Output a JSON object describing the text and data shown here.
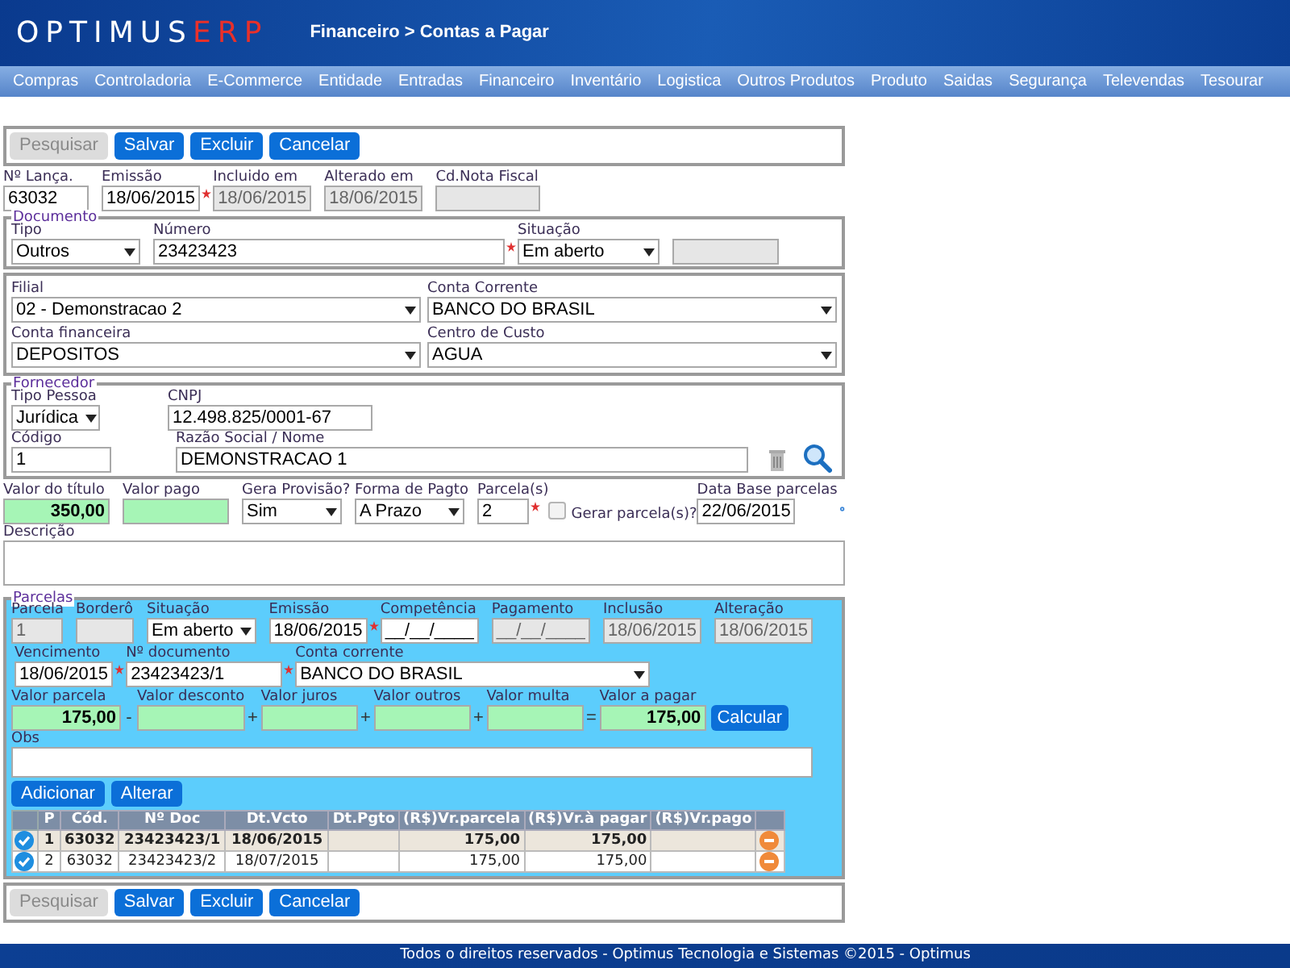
{
  "header": {
    "logo": [
      "OPTIMUS",
      "ERP"
    ],
    "breadcrumb": "Financeiro > Contas a Pagar"
  },
  "menu": [
    "Compras",
    "Controladoria",
    "E-Commerce",
    "Entidade",
    "Entradas",
    "Financeiro",
    "Inventário",
    "Logistica",
    "Outros Produtos",
    "Produto",
    "Saidas",
    "Segurança",
    "Televendas",
    "Tesourar"
  ],
  "toolbar_top": [
    {
      "label": "Pesquisar",
      "disabled": true
    },
    {
      "label": "Salvar",
      "disabled": false
    },
    {
      "label": "Excluir",
      "disabled": false
    },
    {
      "label": "Cancelar",
      "disabled": false
    }
  ],
  "lancamento": [
    {
      "label": "Nº Lança.",
      "kind": "text",
      "value": "63032"
    },
    {
      "label": "Emissão",
      "kind": "text",
      "value": "18/06/2015",
      "required": true
    },
    {
      "label": "Incluido em",
      "kind": "text",
      "value": "18/06/2015",
      "readonly": true
    },
    {
      "label": "Alterado em",
      "kind": "text",
      "value": "18/06/2015",
      "readonly": true
    },
    {
      "label": "Cd.Nota Fiscal",
      "kind": "text",
      "readonly": true
    }
  ],
  "documento": {
    "legend": "Documento",
    "fields": [
      {
        "label": "Tipo",
        "kind": "select",
        "value": "Outros"
      },
      {
        "label": "Número",
        "kind": "text",
        "value": "23423423",
        "required": true
      },
      {
        "label": "Situação",
        "kind": "select",
        "value": "Em aberto"
      },
      {
        "kind": "text",
        "readonly": true
      }
    ]
  },
  "contas": [
    {
      "label": "Filial",
      "kind": "select",
      "value": "02 - Demonstracao 2"
    },
    {
      "label": "Conta Corrente",
      "kind": "select",
      "value": "BANCO DO BRASIL"
    },
    {
      "label": "Conta financeira",
      "kind": "select",
      "value": "DEPOSITOS"
    },
    {
      "label": "Centro de Custo",
      "kind": "select",
      "value": "AGUA"
    }
  ],
  "fornecedor": {
    "legend": "Fornecedor",
    "fields": [
      {
        "label": "Tipo Pessoa",
        "kind": "select",
        "value": "Jurídica"
      },
      {
        "label": "CNPJ",
        "kind": "text",
        "value": "12.498.825/0001-67"
      },
      {
        "label": "Código",
        "kind": "text",
        "value": "1"
      },
      {
        "label": "Razão Social / Nome",
        "kind": "text",
        "value": "DEMONSTRACAO 1"
      }
    ]
  },
  "valores": [
    {
      "label": "Valor do título",
      "kind": "money",
      "value": "350,00"
    },
    {
      "label": "Valor pago",
      "kind": "money"
    },
    {
      "label": "Gera Provisão?",
      "kind": "select",
      "value": "Sim"
    },
    {
      "label": "Forma de Pagto",
      "kind": "select",
      "value": "A Prazo"
    },
    {
      "label": "Parcela(s)",
      "kind": "text",
      "value": "2",
      "required": true
    },
    {
      "label": "Gerar parcela(s)?",
      "kind": "checkbox",
      "checked": false
    },
    {
      "label": "Data Base parcelas",
      "kind": "text",
      "value": "22/06/2015"
    }
  ],
  "descricao": {
    "label": "Descrição"
  },
  "parcelas": {
    "legend": "Parcelas",
    "row1": [
      {
        "label": "Parcela",
        "kind": "text",
        "value": "1",
        "readonly": true
      },
      {
        "label": "Borderô",
        "kind": "text",
        "readonly": true
      },
      {
        "label": "Situação",
        "kind": "select",
        "value": "Em aberto"
      },
      {
        "label": "Emissão",
        "kind": "text",
        "value": "18/06/2015",
        "required": true
      },
      {
        "label": "Competência",
        "kind": "text",
        "value": "__/__/____"
      },
      {
        "label": "Pagamento",
        "kind": "text",
        "value": "__/__/____",
        "readonly": true
      },
      {
        "label": "Inclusão",
        "kind": "text",
        "value": "18/06/2015",
        "readonly": true
      },
      {
        "label": "Alteração",
        "kind": "text",
        "value": "18/06/2015",
        "readonly": true
      }
    ],
    "row2": [
      {
        "label": "Vencimento",
        "kind": "text",
        "value": "18/06/2015",
        "required": true
      },
      {
        "label": "Nº documento",
        "kind": "text",
        "value": "23423423/1",
        "required": true
      },
      {
        "label": "Conta corrente",
        "kind": "select",
        "value": "BANCO DO BRASIL"
      }
    ],
    "row3": [
      {
        "label": "Valor parcela",
        "kind": "money",
        "value": "175,00",
        "operator": "-"
      },
      {
        "label": "Valor desconto",
        "kind": "money",
        "operator": "+"
      },
      {
        "label": "Valor juros",
        "kind": "money",
        "operator": "+"
      },
      {
        "label": "Valor outros",
        "kind": "money",
        "operator": "+"
      },
      {
        "label": "Valor multa",
        "kind": "money",
        "operator": "="
      },
      {
        "label": "Valor a pagar",
        "kind": "money",
        "value": "175,00"
      }
    ],
    "calculate_button": "Calcular",
    "obs": {
      "label": "Obs"
    },
    "buttons": [
      "Adicionar",
      "Alterar"
    ],
    "table": {
      "columns": [
        "P",
        "Cód.",
        "Nº Doc",
        "Dt.Vcto",
        "Dt.Pgto",
        "(R$)Vr.parcela",
        "(R$)Vr.à pagar",
        "(R$)Vr.pago"
      ],
      "rows": [
        {
          "selected": true,
          "cells": [
            "1",
            "63032",
            "23423423/1",
            "18/06/2015",
            null,
            "175,00",
            "175,00",
            null
          ]
        },
        {
          "selected": false,
          "cells": [
            "2",
            "63032",
            "23423423/2",
            "18/07/2015",
            null,
            "175,00",
            "175,00",
            null
          ]
        }
      ]
    }
  },
  "toolbar_bottom": [
    {
      "label": "Pesquisar",
      "disabled": true
    },
    {
      "label": "Salvar",
      "disabled": false
    },
    {
      "label": "Excluir",
      "disabled": false
    },
    {
      "label": "Cancelar",
      "disabled": false
    }
  ],
  "footer": "Todos o direitos reservados - Optimus Tecnologia e Sistemas ©2015 - Optimus"
}
